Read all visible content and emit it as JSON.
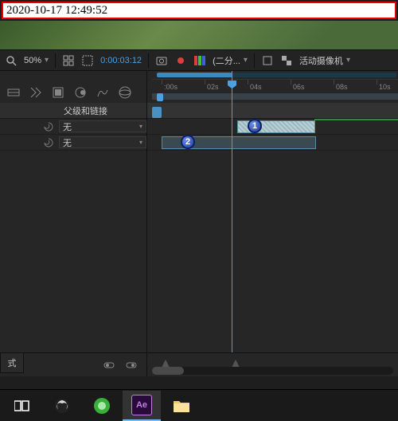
{
  "timestamp": "2020-10-17 12:49:52",
  "toolbar": {
    "zoom": "50%",
    "timecode": "0:00:03:12",
    "resolution": "(二分...",
    "camera": "活动摄像机"
  },
  "layer_header": "父级和链接",
  "layers": [
    {
      "parent": "无"
    },
    {
      "parent": "无"
    }
  ],
  "ruler": {
    "ticks": [
      ":00s",
      "02s",
      "04s",
      "06s",
      "08s",
      "10s"
    ]
  },
  "callouts": [
    "1",
    "2"
  ],
  "mode_label": "式",
  "chart_data": {
    "type": "table",
    "title": "After Effects timeline",
    "playhead_time": "0:00:03:12",
    "time_axis_seconds": [
      0,
      2,
      4,
      6,
      8,
      10
    ],
    "layers": [
      {
        "index": 1,
        "parent": "无",
        "clip_start_s": 3.5,
        "clip_end_s": 7.0,
        "selected": true
      },
      {
        "index": 2,
        "parent": "无",
        "clip_start_s": 0.0,
        "clip_end_s": 7.0,
        "selected": false
      }
    ]
  }
}
